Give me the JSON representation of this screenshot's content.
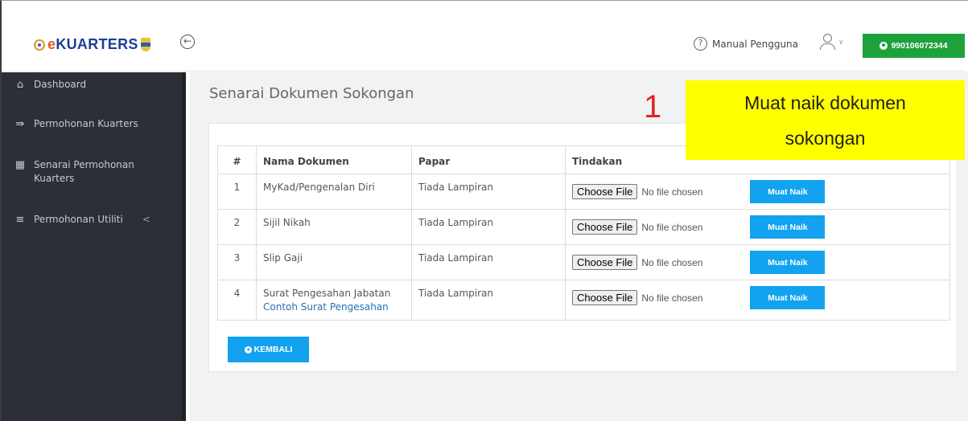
{
  "header": {
    "logo_text_e": "e",
    "logo_text_rest": "KUARTERS",
    "manual_label": "Manual Pengguna",
    "account_id": "990106072344"
  },
  "sidebar": {
    "items": [
      {
        "label": "Dashboard",
        "icon": "home-icon"
      },
      {
        "label": "Permohonan Kuarters",
        "icon": "door-icon"
      },
      {
        "label": "Senarai Permohonan Kuarters",
        "icon": "building-icon"
      },
      {
        "label": "Permohonan Utiliti",
        "icon": "layers-icon",
        "arrow": "<"
      }
    ]
  },
  "main": {
    "title": "Senarai Dokumen Sokongan",
    "table": {
      "headers": [
        "#",
        "Nama Dokumen",
        "Papar",
        "Tindakan"
      ],
      "file_button_label": "Choose File",
      "file_status": "No file chosen",
      "upload_label": "Muat Naik",
      "rows": [
        {
          "num": "1",
          "name": "MyKad/Pengenalan Diri",
          "papar": "Tiada Lampiran",
          "link": ""
        },
        {
          "num": "2",
          "name": "Sijil Nikah",
          "papar": "Tiada Lampiran",
          "link": ""
        },
        {
          "num": "3",
          "name": "Slip Gaji",
          "papar": "Tiada Lampiran",
          "link": ""
        },
        {
          "num": "4",
          "name": "Surat Pengesahan Jabatan",
          "papar": "Tiada Lampiran",
          "link": "Contoh Surat Pengesahan"
        }
      ]
    },
    "back_label": "KEMBALI"
  },
  "annotation": {
    "step": "1",
    "line1": "Muat naik dokumen",
    "line2": "sokongan"
  },
  "colors": {
    "sidebar_bg": "#2c2f36",
    "accent_blue": "#12a2ef",
    "account_green": "#1da23b",
    "callout_yellow": "#ffff00",
    "step_red": "#e32222"
  }
}
